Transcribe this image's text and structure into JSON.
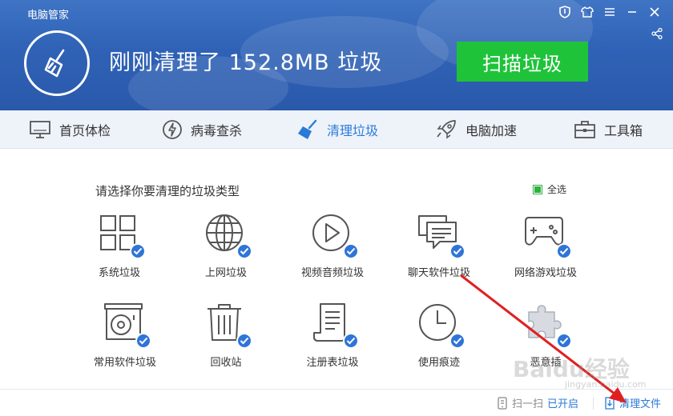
{
  "app": {
    "title": "电脑管家"
  },
  "header": {
    "headline": "刚刚清理了 152.8MB 垃圾",
    "scan_button": "扫描垃圾"
  },
  "tabs": [
    {
      "label": "首页体检",
      "icon": "monitor-icon",
      "active": false
    },
    {
      "label": "病毒查杀",
      "icon": "lightning-icon",
      "active": false
    },
    {
      "label": "清理垃圾",
      "icon": "broom-icon",
      "active": true
    },
    {
      "label": "电脑加速",
      "icon": "rocket-icon",
      "active": false
    },
    {
      "label": "工具箱",
      "icon": "toolbox-icon",
      "active": false
    }
  ],
  "main": {
    "prompt": "请选择你要清理的垃圾类型",
    "select_all": {
      "label": "全选",
      "checked": true
    },
    "categories": [
      {
        "label": "系统垃圾",
        "icon": "windows-icon",
        "checked": true
      },
      {
        "label": "上网垃圾",
        "icon": "globe-icon",
        "checked": true
      },
      {
        "label": "视频音频垃圾",
        "icon": "play-icon",
        "checked": true
      },
      {
        "label": "聊天软件垃圾",
        "icon": "chat-icon",
        "checked": true
      },
      {
        "label": "网络游戏垃圾",
        "icon": "gamepad-icon",
        "checked": true
      },
      {
        "label": "常用软件垃圾",
        "icon": "disc-drive-icon",
        "checked": true
      },
      {
        "label": "回收站",
        "icon": "trash-icon",
        "checked": true
      },
      {
        "label": "注册表垃圾",
        "icon": "document-icon",
        "checked": true
      },
      {
        "label": "使用痕迹",
        "icon": "clock-icon",
        "checked": true
      },
      {
        "label": "恶意插",
        "icon": "puzzle-icon",
        "checked": true
      }
    ]
  },
  "footer": {
    "scan_label": "扫一扫",
    "scan_status": "已开启",
    "clean_files": "清理文件"
  },
  "watermark": {
    "logo": "Baidu经验",
    "url": "jingyan.baidu.com"
  },
  "colors": {
    "header_blue": "#2f62b6",
    "scan_green": "#1fc33a",
    "accent_blue": "#2b7ad7",
    "check_blue": "#2f75d8",
    "arrow_red": "#e02020"
  }
}
